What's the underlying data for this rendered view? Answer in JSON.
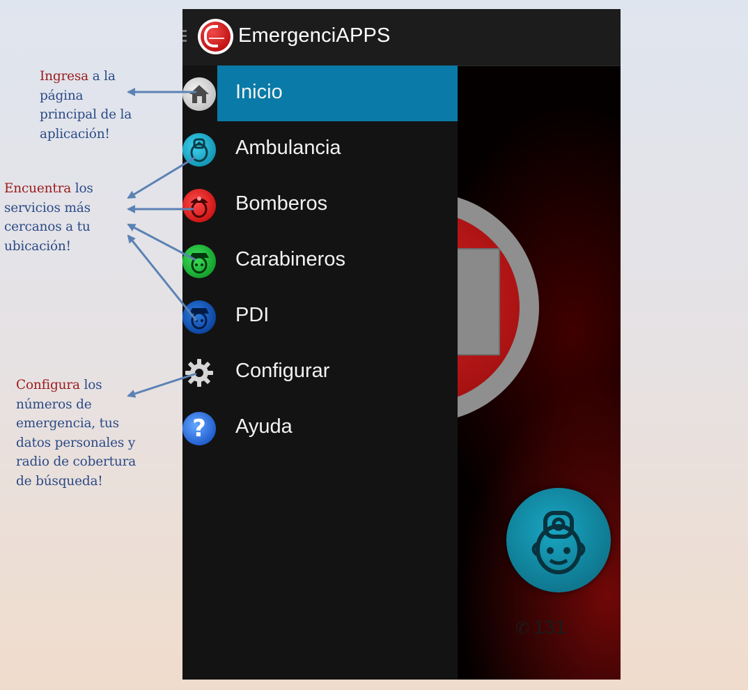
{
  "annotations": {
    "inicio": {
      "keyword": "Ingresa",
      "rest": [
        " a la",
        "página",
        "principal de la",
        "aplicación!"
      ]
    },
    "servicios": {
      "keyword": "Encuentra",
      "rest": [
        " los",
        "servicios más",
        "cercanos a tu",
        "ubicación!"
      ]
    },
    "configurar": {
      "keyword": "Configura",
      "rest": [
        " los",
        "números de",
        "emergencia, tus",
        "datos personales y",
        "radio de cobertura",
        "de búsqueda!"
      ]
    }
  },
  "app": {
    "title": "EmergenciAPPS"
  },
  "drawer": {
    "items": [
      {
        "label": "Inicio",
        "icon": "home-icon",
        "active": true
      },
      {
        "label": "Ambulancia",
        "icon": "ambulance-icon"
      },
      {
        "label": "Bomberos",
        "icon": "firefighter-icon"
      },
      {
        "label": "Carabineros",
        "icon": "police-icon"
      },
      {
        "label": "PDI",
        "icon": "pdi-icon"
      },
      {
        "label": "Configurar",
        "icon": "gear-icon"
      },
      {
        "label": "Ayuda",
        "icon": "help-icon"
      }
    ]
  },
  "main": {
    "phone_number": "131"
  },
  "colors": {
    "accent": "#0a7ba8",
    "keyword": "#9b1c1c",
    "annotation_text": "#2b4a86",
    "arrow": "#5b82b4"
  }
}
